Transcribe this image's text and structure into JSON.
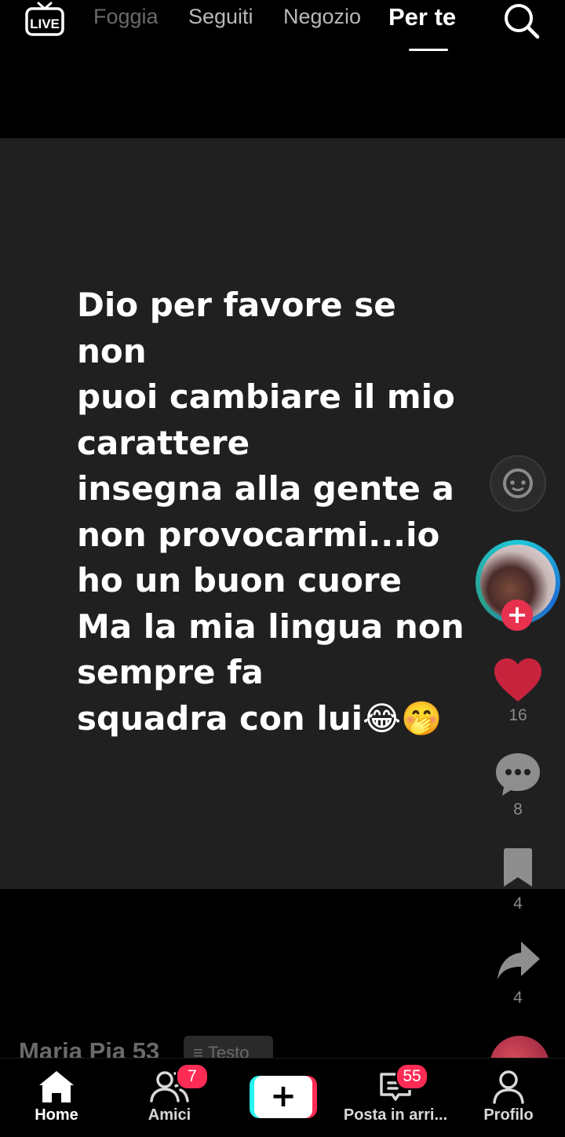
{
  "top_nav": {
    "live_label": "LIVE",
    "tabs": [
      {
        "label": "Foggia"
      },
      {
        "label": "Seguiti"
      },
      {
        "label": "Negozio"
      },
      {
        "label": "Per te",
        "active": true
      }
    ]
  },
  "video": {
    "text_lines": [
      "Dio per favore se",
      "non",
      "puoi cambiare il mio",
      "carattere",
      "insegna alla gente a",
      "non provocarmi...io",
      "ho un buon cuore",
      "Ma la mia lingua non",
      "sempre fa",
      "squadra con lui😂🤭"
    ],
    "author": "Maria Pia 53",
    "text_chip": "Testo"
  },
  "actions": {
    "follow_symbol": "+",
    "likes": "16",
    "comments": "8",
    "bookmarks": "4",
    "shares": "4"
  },
  "bottom_nav": {
    "items": [
      {
        "label": "Home",
        "icon": "home-icon",
        "active": true
      },
      {
        "label": "Amici",
        "icon": "friends-icon",
        "badge": "7"
      },
      {
        "label": "",
        "icon": "create-plus-icon"
      },
      {
        "label": "Posta in arri...",
        "icon": "inbox-icon",
        "badge": "55"
      },
      {
        "label": "Profilo",
        "icon": "profile-icon"
      }
    ]
  },
  "colors": {
    "accent_red": "#fe2c55",
    "accent_cyan": "#25f4ee",
    "video_bg": "#202021",
    "like_heart": "#c8233d"
  }
}
